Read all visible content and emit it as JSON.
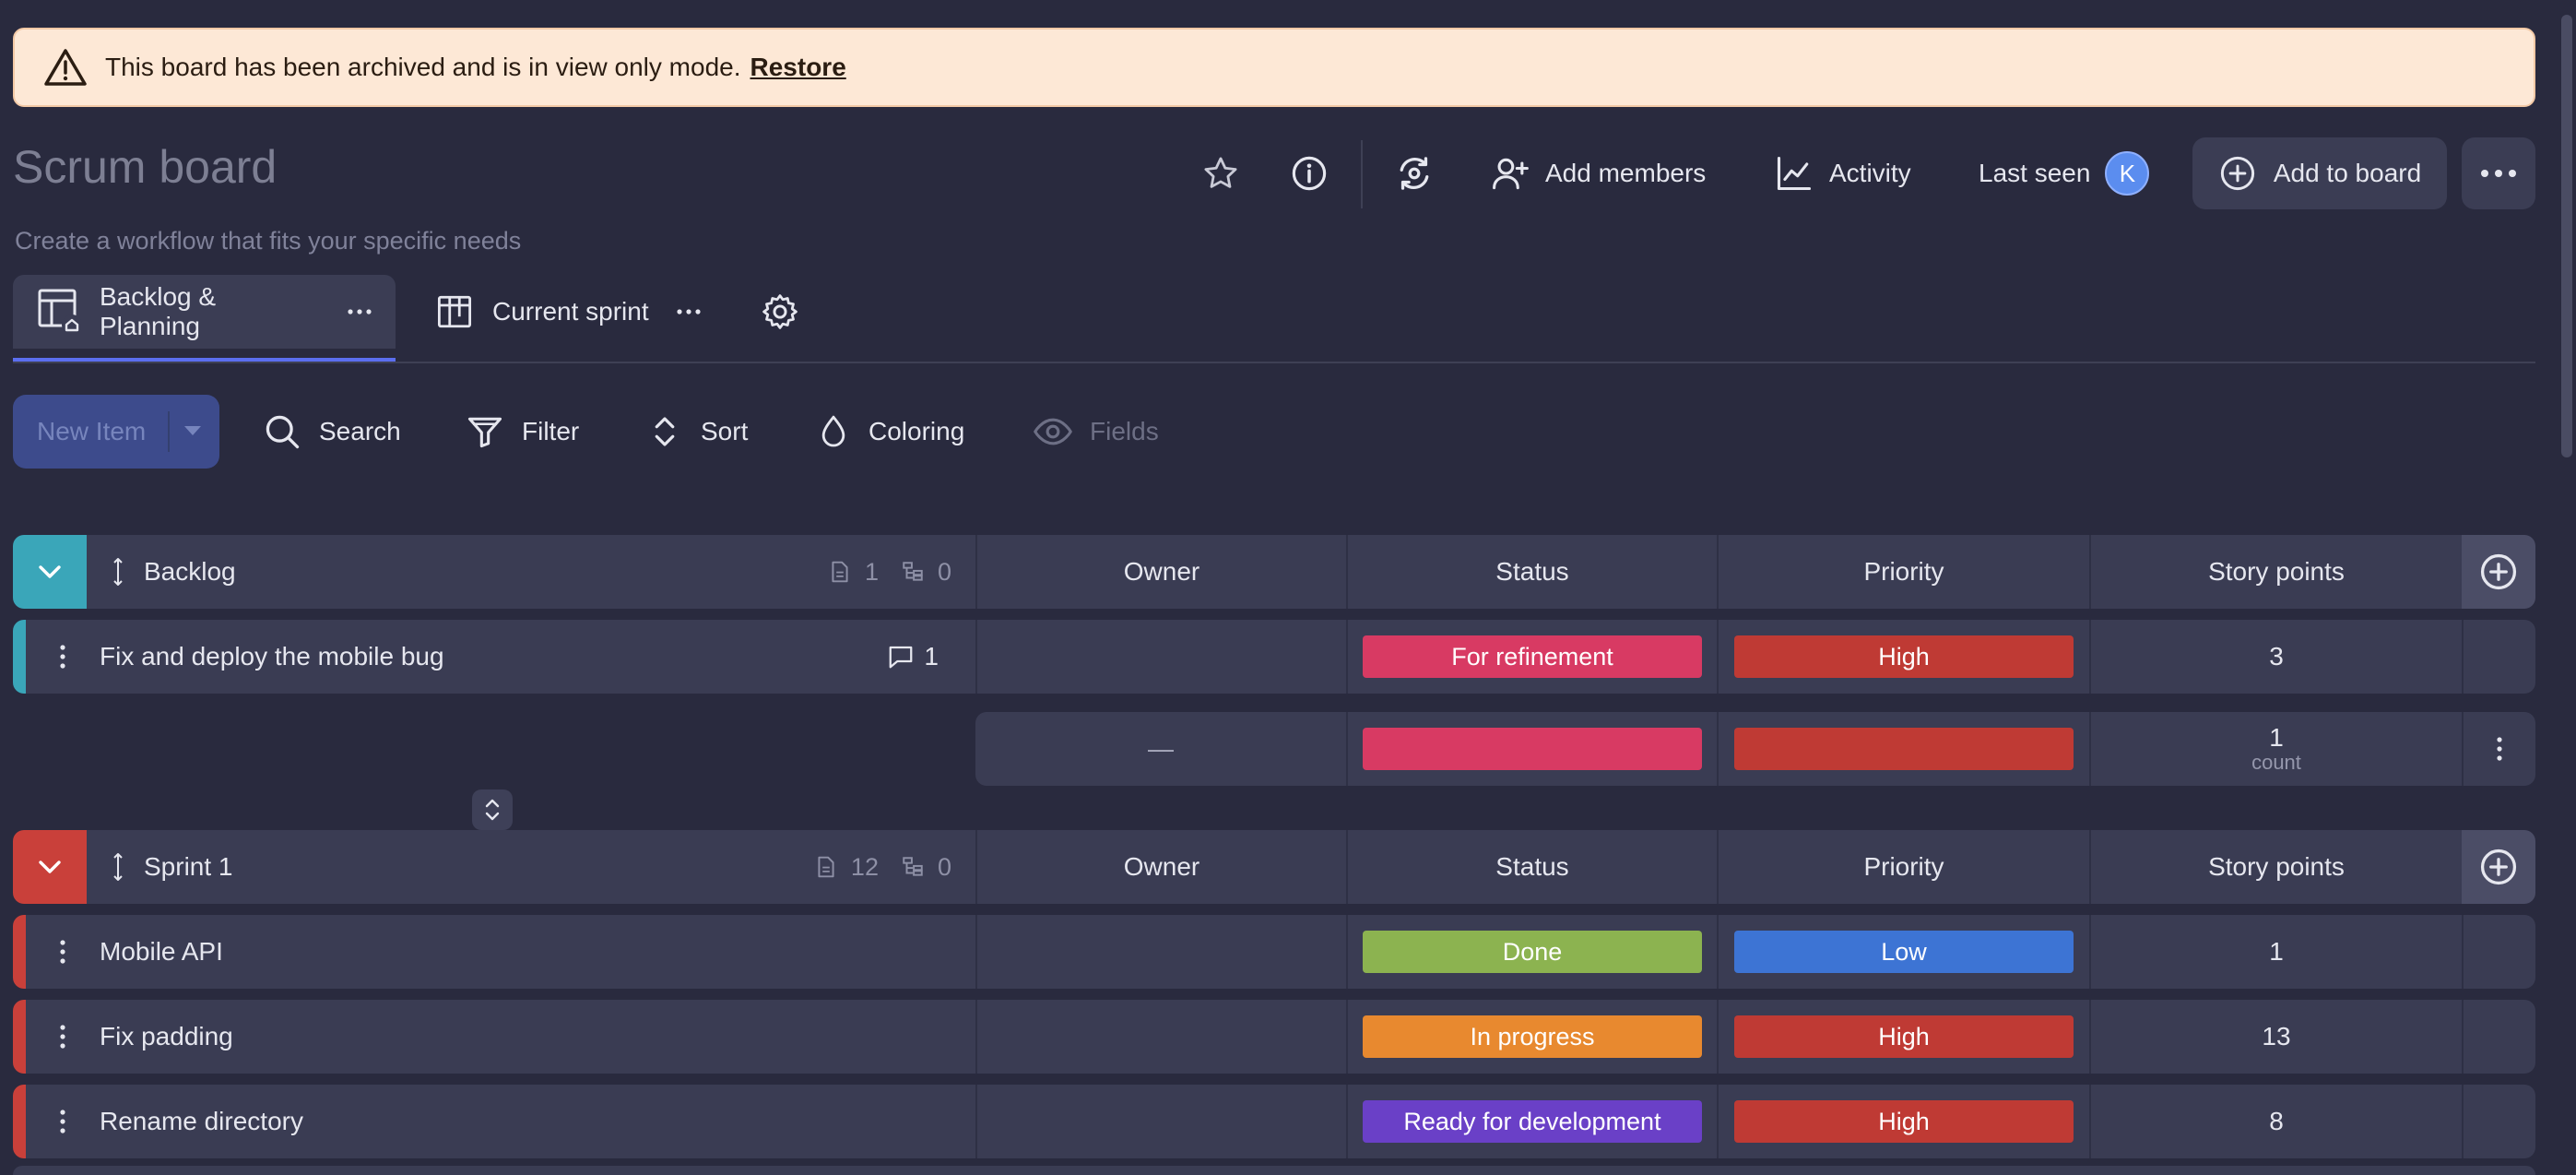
{
  "banner": {
    "message": "This board has been archived and is in view only mode.",
    "restore_label": "Restore"
  },
  "board": {
    "title": "Scrum board",
    "description": "Create a workflow that fits your specific needs"
  },
  "header": {
    "add_members_label": "Add members",
    "activity_label": "Activity",
    "last_seen_label": "Last seen",
    "avatar_initial": "K",
    "add_to_board_label": "Add to board"
  },
  "tabs": [
    {
      "label": "Backlog & Planning",
      "active": true
    },
    {
      "label": "Current sprint",
      "active": false
    }
  ],
  "toolbar": {
    "new_item_label": "New Item",
    "search_label": "Search",
    "filter_label": "Filter",
    "sort_label": "Sort",
    "coloring_label": "Coloring",
    "fields_label": "Fields"
  },
  "columns": {
    "owner": "Owner",
    "status": "Status",
    "priority": "Priority",
    "story_points": "Story points"
  },
  "groups": [
    {
      "name": "Backlog",
      "color": "#3aa6b9",
      "item_count": "1",
      "subitem_count": "0",
      "items": [
        {
          "name": "Fix and deploy the mobile bug",
          "comments": "1",
          "status": "For refinement",
          "status_color": "#d83a63",
          "priority": "High",
          "priority_color": "#bf3a34",
          "story_points": "3"
        }
      ],
      "summary": {
        "owner": "—",
        "count": "1",
        "count_label": "count",
        "status_color": "#d83a63",
        "priority_color": "#bf3a34"
      }
    },
    {
      "name": "Sprint 1",
      "color": "#c9403a",
      "item_count": "12",
      "subitem_count": "0",
      "items": [
        {
          "name": "Mobile API",
          "status": "Done",
          "status_color": "#8cb350",
          "priority": "Low",
          "priority_color": "#3d74d4",
          "story_points": "1"
        },
        {
          "name": "Fix padding",
          "status": "In progress",
          "status_color": "#e8892f",
          "priority": "High",
          "priority_color": "#bf3a34",
          "story_points": "13"
        },
        {
          "name": "Rename directory",
          "status": "Ready for development",
          "status_color": "#6a40c7",
          "priority": "High",
          "priority_color": "#bf3a34",
          "story_points": "8"
        }
      ]
    }
  ]
}
